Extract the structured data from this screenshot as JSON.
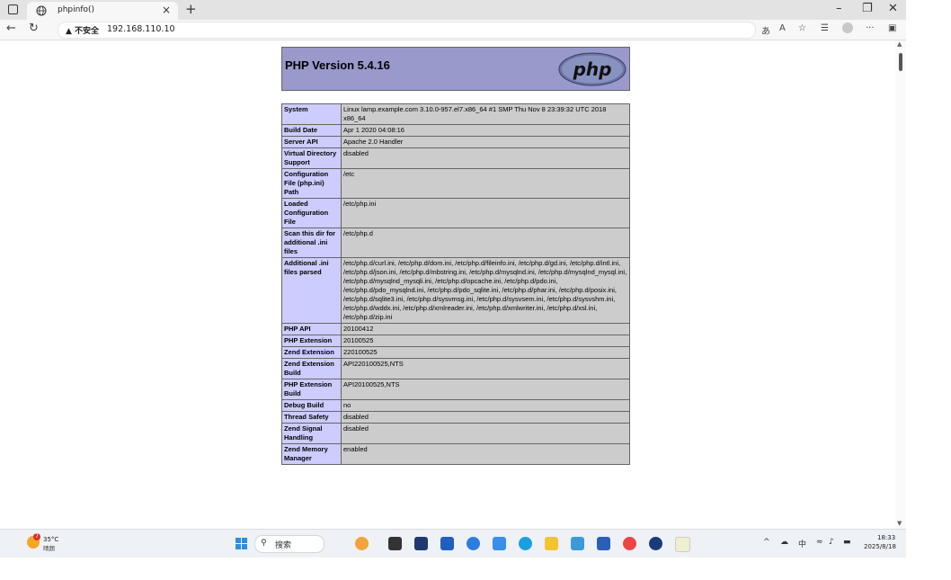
{
  "browser": {
    "tab_title": "phpinfo()",
    "tab_close": "×",
    "new_tab": "+",
    "address_warning": "▲ 不安全",
    "url": "192.168.110.10"
  },
  "page": {
    "php_version": "PHP Version 5.4.16",
    "logo_text": "php",
    "rows": [
      {
        "key": "System",
        "value": "Linux lamp.example.com 3.10.0-957.el7.x86_64 #1 SMP Thu Nov 8 23:39:32 UTC 2018 x86_64"
      },
      {
        "key": "Build Date",
        "value": "Apr 1 2020 04:08:16"
      },
      {
        "key": "Server API",
        "value": "Apache 2.0 Handler"
      },
      {
        "key": "Virtual Directory Support",
        "value": "disabled"
      },
      {
        "key": "Configuration File (php.ini) Path",
        "value": "/etc"
      },
      {
        "key": "Loaded Configuration File",
        "value": "/etc/php.ini"
      },
      {
        "key": "Scan this dir for additional .ini files",
        "value": "/etc/php.d"
      },
      {
        "key": "Additional .ini files parsed",
        "value": "/etc/php.d/curl.ini, /etc/php.d/dom.ini, /etc/php.d/fileinfo.ini, /etc/php.d/gd.ini, /etc/php.d/intl.ini, /etc/php.d/json.ini, /etc/php.d/mbstring.ini, /etc/php.d/mysqlnd.ini, /etc/php.d/mysqlnd_mysql.ini, /etc/php.d/mysqlnd_mysqli.ini, /etc/php.d/opcache.ini, /etc/php.d/pdo.ini, /etc/php.d/pdo_mysqlnd.ini, /etc/php.d/pdo_sqlite.ini, /etc/php.d/phar.ini, /etc/php.d/posix.ini, /etc/php.d/sqlite3.ini, /etc/php.d/sysvmsg.ini, /etc/php.d/sysvsem.ini, /etc/php.d/sysvshm.ini, /etc/php.d/wddx.ini, /etc/php.d/xmlreader.ini, /etc/php.d/xmlwriter.ini, /etc/php.d/xsl.ini, /etc/php.d/zip.ini"
      },
      {
        "key": "PHP API",
        "value": "20100412"
      },
      {
        "key": "PHP Extension",
        "value": "20100525"
      },
      {
        "key": "Zend Extension",
        "value": "220100525"
      },
      {
        "key": "Zend Extension Build",
        "value": "API220100525,NTS"
      },
      {
        "key": "PHP Extension Build",
        "value": "API20100525,NTS"
      },
      {
        "key": "Debug Build",
        "value": "no"
      },
      {
        "key": "Thread Safety",
        "value": "disabled"
      },
      {
        "key": "Zend Signal Handling",
        "value": "disabled"
      },
      {
        "key": "Zend Memory Manager",
        "value": "enabled"
      }
    ]
  },
  "taskbar": {
    "weather_badge": "7",
    "weather_temp": "35°C",
    "weather_desc": "晴朗",
    "search_placeholder": "搜索",
    "tray_ime": "中",
    "clock_time": "18:33",
    "clock_date": "2025/8/18"
  },
  "colors": {
    "php_header": "#9999cc",
    "php_key_cell": "#ccccff",
    "php_value_cell": "#cccccc"
  }
}
